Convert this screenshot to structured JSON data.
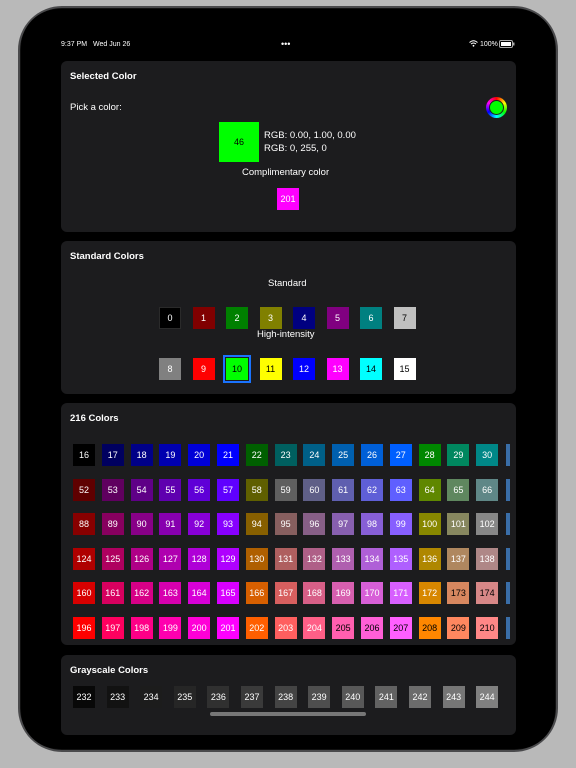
{
  "status": {
    "time": "9:37 PM",
    "date": "Wed Jun 26",
    "battery": "100%"
  },
  "selected": {
    "title": "Selected Color",
    "pick_label": "Pick a color:",
    "current_index": "46",
    "current_color": "#00ff00",
    "rgb_float": "RGB:  0.00, 1.00, 0.00",
    "rgb_int": "RGB:  0, 255, 0",
    "comp_label": "Complimentary color",
    "comp_index": "201",
    "comp_color": "#ff00ff"
  },
  "standard": {
    "title": "Standard Colors",
    "standard_label": "Standard",
    "high_label": "High-intensity",
    "standard_swatches": [
      {
        "n": "0",
        "c": "#000000"
      },
      {
        "n": "1",
        "c": "#800000"
      },
      {
        "n": "2",
        "c": "#008000"
      },
      {
        "n": "3",
        "c": "#808000"
      },
      {
        "n": "4",
        "c": "#000080"
      },
      {
        "n": "5",
        "c": "#800080"
      },
      {
        "n": "6",
        "c": "#008080"
      },
      {
        "n": "7",
        "c": "#c0c0c0"
      }
    ],
    "high_swatches": [
      {
        "n": "8",
        "c": "#808080"
      },
      {
        "n": "9",
        "c": "#ff0000"
      },
      {
        "n": "10",
        "c": "#00ff00"
      },
      {
        "n": "11",
        "c": "#ffff00"
      },
      {
        "n": "12",
        "c": "#0000ff"
      },
      {
        "n": "13",
        "c": "#ff00ff"
      },
      {
        "n": "14",
        "c": "#00ffff"
      },
      {
        "n": "15",
        "c": "#ffffff"
      }
    ]
  },
  "colors216": {
    "title": "216 Colors",
    "rows": [
      [
        "16",
        "17",
        "18",
        "19",
        "20",
        "21",
        "22",
        "23",
        "24",
        "25",
        "26",
        "27",
        "28",
        "29",
        "30"
      ],
      [
        "52",
        "53",
        "54",
        "55",
        "56",
        "57",
        "58",
        "59",
        "60",
        "61",
        "62",
        "63",
        "64",
        "65",
        "66"
      ],
      [
        "88",
        "89",
        "90",
        "91",
        "92",
        "93",
        "94",
        "95",
        "96",
        "97",
        "98",
        "99",
        "100",
        "101",
        "102"
      ],
      [
        "124",
        "125",
        "126",
        "127",
        "128",
        "129",
        "130",
        "131",
        "132",
        "133",
        "134",
        "135",
        "136",
        "137",
        "138"
      ],
      [
        "160",
        "161",
        "162",
        "163",
        "164",
        "165",
        "166",
        "167",
        "168",
        "169",
        "170",
        "171",
        "172",
        "173",
        "174"
      ],
      [
        "196",
        "197",
        "198",
        "199",
        "200",
        "201",
        "202",
        "203",
        "204",
        "205",
        "206",
        "207",
        "208",
        "209",
        "210"
      ]
    ]
  },
  "grayscale": {
    "title": "Grayscale Colors",
    "values": [
      "232",
      "233",
      "234",
      "235",
      "236",
      "237",
      "238",
      "239",
      "240",
      "241",
      "242",
      "243",
      "244"
    ]
  }
}
